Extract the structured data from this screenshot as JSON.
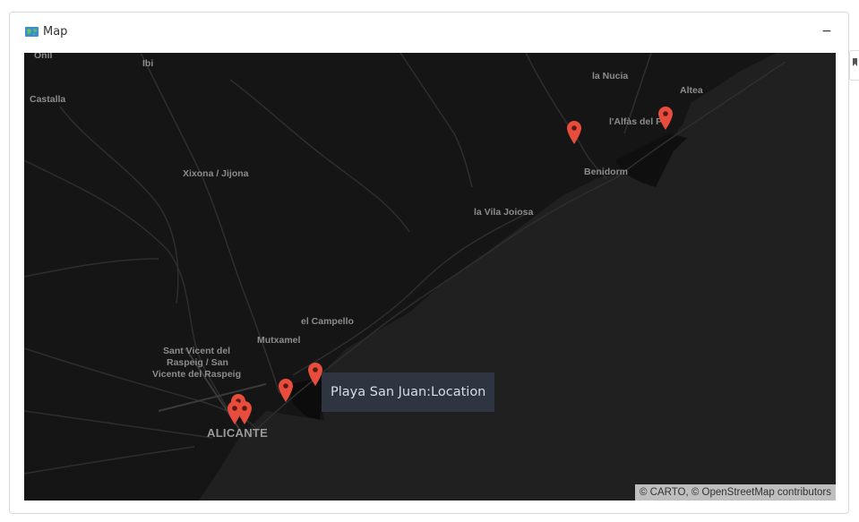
{
  "panel": {
    "title": "Map",
    "icon": "world-map-icon",
    "collapse_label": "−"
  },
  "map": {
    "places": {
      "onil": "Onil",
      "ibi": "Ibi",
      "castalla": "Castalla",
      "la_nucia": "la Nucia",
      "altea": "Altea",
      "alfas": "l'Alfàs del Pi",
      "benidorm": "Benidorm",
      "xixona": "Xixona / Jijona",
      "vila_joiosa": "la Vila Joiosa",
      "el_campello": "el Campello",
      "mutxamel": "Mutxamel",
      "sant_vicent_1": "Sant Vicent del",
      "sant_vicent_2": "Raspeig / San",
      "sant_vicent_3": "Vicente del Raspeig",
      "alicante": "ALICANTE"
    },
    "markers": [
      {
        "id": "marker-1",
        "color": "#e74c3c"
      },
      {
        "id": "marker-2",
        "color": "#e74c3c"
      },
      {
        "id": "marker-3",
        "color": "#e74c3c"
      },
      {
        "id": "marker-4",
        "color": "#e74c3c"
      },
      {
        "id": "marker-5",
        "color": "#e74c3c"
      },
      {
        "id": "marker-6",
        "color": "#e74c3c"
      },
      {
        "id": "marker-7",
        "color": "#e74c3c"
      }
    ],
    "tooltip": "Playa San Juan:Location",
    "attribution": "© CARTO, © OpenStreetMap contributors",
    "colors": {
      "land": "#141414",
      "sea": "#1f1f1f",
      "roads": "#2b2b2b",
      "marker": "#e74c3c"
    }
  }
}
